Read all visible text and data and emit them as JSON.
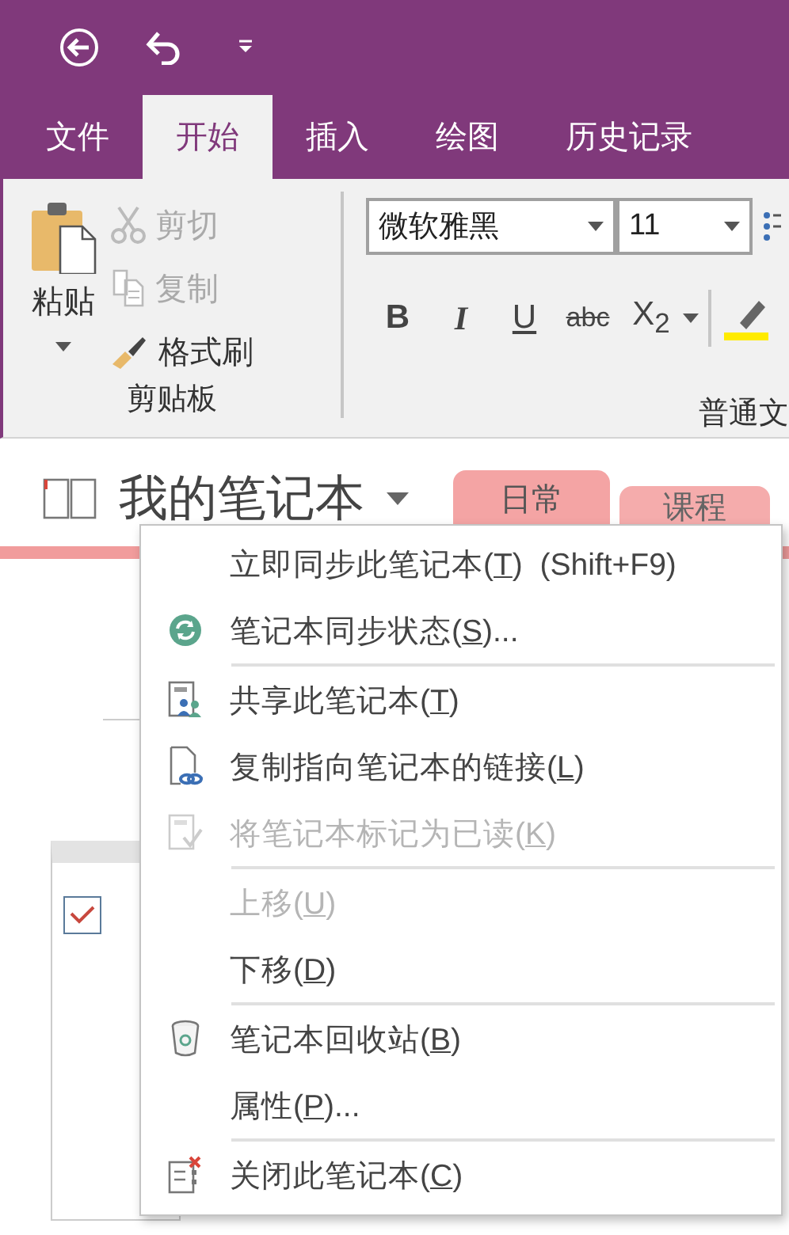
{
  "ribbon_tabs": [
    {
      "label": "文件",
      "selected": false
    },
    {
      "label": "开始",
      "selected": true
    },
    {
      "label": "插入",
      "selected": false
    },
    {
      "label": "绘图",
      "selected": false
    },
    {
      "label": "历史记录",
      "selected": false
    }
  ],
  "clipboard": {
    "paste": "粘贴",
    "label": "剪贴板",
    "actions": [
      {
        "label": "剪切",
        "disabled": true
      },
      {
        "label": "复制",
        "disabled": true
      },
      {
        "label": "格式刷",
        "disabled": false
      }
    ]
  },
  "font": {
    "family": "微软雅黑",
    "size": "11",
    "format_buttons": [
      "B",
      "I",
      "U",
      "abc",
      "X$_{2}$"
    ],
    "label": "普通文"
  },
  "notebook": {
    "title": "我的笔记本",
    "sections": [
      {
        "label": "日常",
        "selected": true,
        "color": "#f4a4a4"
      },
      {
        "label": "课程",
        "selected": false,
        "color": "#f4a4a4"
      }
    ]
  },
  "page": {
    "checkbox": {
      "checked": true
    }
  },
  "context_menu": {
    "groups": [
      {
        "items": [
          {
            "text": "立即同步此笔记本(",
            "key": "T",
            "rest": ")  (Shift+F9)",
            "disabled": false
          },
          {
            "text": "笔记本同步状态(",
            "key": "S",
            "rest": ")...",
            "disabled": false
          }
        ]
      },
      {
        "items": [
          {
            "text": "共享此笔记本(",
            "key": "T",
            "rest": ")",
            "disabled": false
          },
          {
            "text": "复制指向笔记本的链接(",
            "key": "L",
            "rest": ")",
            "disabled": false
          },
          {
            "text": "将笔记本标记为已读(",
            "key": "K",
            "rest": ")",
            "disabled": true
          }
        ]
      },
      {
        "items": [
          {
            "text": "上移(",
            "key": "U",
            "rest": ")",
            "disabled": true
          },
          {
            "text": "下移(",
            "key": "D",
            "rest": ")",
            "disabled": false
          }
        ]
      },
      {
        "items": [
          {
            "text": "笔记本回收站(",
            "key": "B",
            "rest": ")",
            "disabled": false
          },
          {
            "text": "属性(",
            "key": "P",
            "rest": ")...",
            "disabled": false
          }
        ]
      },
      {
        "items": [
          {
            "text": "关闭此笔记本(",
            "key": "C",
            "rest": ")",
            "disabled": false
          }
        ]
      }
    ]
  }
}
